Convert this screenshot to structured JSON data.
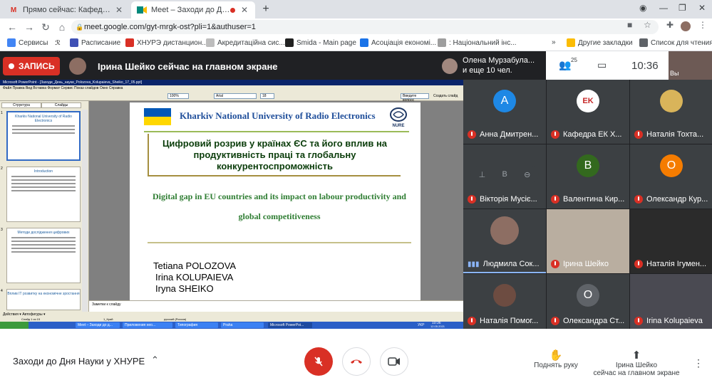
{
  "browser": {
    "tabs": [
      {
        "title": "Прямо сейчас: Кафедра ЕК ХНУ",
        "favicon": "gmail-icon"
      },
      {
        "title": "Meet – Заходи до Дня Науки",
        "favicon": "meet-icon"
      }
    ],
    "new_tab": "+",
    "url": "meet.google.com/gyt-mrgk-ost?pli=1&authuser=1",
    "bookmarks": [
      "Сервисы",
      "Расписание",
      "ХНУРЭ дистанцион...",
      "Акредитаційна сис...",
      "Smida - Main page",
      "Асоціація економі...",
      ": Національний інс..."
    ],
    "bookmarks_more": "»",
    "other_bookmarks": "Другие закладки",
    "reading_list": "Список для чтения"
  },
  "meet": {
    "record_label": "ЗАПИСЬ",
    "presenting_text": "Ірина Шейко сейчас на главном экране",
    "others_line1": "Олена Мурзабула...",
    "others_line2": "и еще 10 чел.",
    "participants_count": "25",
    "time": "10:36",
    "self_label": "Вы",
    "meeting_name": "Заходи до Дня Науки у ХНУРЕ",
    "raise_hand_label": "Поднять руку",
    "presenting_line1": "Ірина Шейко",
    "presenting_line2": "сейчас на главном экране"
  },
  "participants": [
    {
      "name": "Анна Дмитрен...",
      "initial": "A",
      "color": "#1e88e5"
    },
    {
      "name": "Кафедра ЕК Х...",
      "initial": "",
      "color": "#ffffff"
    },
    {
      "name": "Наталія Тохта...",
      "initial": "",
      "color": "#d9b45a"
    },
    {
      "name": "Вікторія Мусіє...",
      "initial": "В",
      "color": "#5f6368"
    },
    {
      "name": "Валентина Кир...",
      "initial": "В",
      "color": "#33691e"
    },
    {
      "name": "Олександр Кур...",
      "initial": "O",
      "color": "#f57c00"
    },
    {
      "name": "Людмила Сок...",
      "initial": "",
      "color": "#8d6e63"
    },
    {
      "name": "Ірина Шейко",
      "initial": "",
      "color": ""
    },
    {
      "name": "Наталія Ігумен...",
      "initial": "",
      "color": ""
    },
    {
      "name": "Наталія Помог...",
      "initial": "",
      "color": "#6d4c41"
    },
    {
      "name": "Олександра Ст...",
      "initial": "O",
      "color": "#5f6368"
    },
    {
      "name": "Irina Kolupaieva",
      "initial": "",
      "color": ""
    }
  ],
  "ppt": {
    "window_title": "Microsoft PowerPoint - [Заходи_День_науки_Polozova_Kolupaieva_Sheiko_17_05.ppt]",
    "menu": "Файл   Правка   Вид   Вставка   Формат   Сервис   Показ слайдов   Окно   Справка",
    "zoom": "100%",
    "font": "Arial",
    "size": "18",
    "new_slide": "Создать слайд",
    "help_placeholder": "Введите вопрос",
    "left_tabs": [
      "Структура",
      "Слайды"
    ],
    "thumb_titles": [
      "Kharkiv National University of Radio Electronics",
      "Introduction",
      "Методи дослідження цифрових",
      "Вплив ІТ розвитку на економічне зростання"
    ],
    "notes_placeholder": "Заметки к слайду",
    "draw_label": "Действия ▾    Автофигуры ▾",
    "status_slide": "Слайд 1 из 15",
    "status_design": "1_Край",
    "status_lang": "русский (Россия)",
    "taskbar_items": [
      "Meet – Заходи до д...",
      "Приложения нео...",
      "Типография",
      "Praha",
      "Microsoft PowerPoi..."
    ],
    "taskbar_time": "10:36",
    "taskbar_date": "12.05.2021",
    "taskbar_lang": "УКР"
  },
  "slide": {
    "university": "Kharkiv National University of Radio Electronics",
    "logo_text": "NURE",
    "title_ua": "Цифровий розрив у країнах ЄС та його вплив на продуктивність праці та глобальну конкурентоспроможність",
    "title_en": "Digital gap in EU countries and its impact on labour productivity and global competitiveness",
    "authors": [
      "Tetiana POLOZOVA",
      "Irina KOLUPAIEVA",
      "Iryna SHEIKO"
    ]
  }
}
